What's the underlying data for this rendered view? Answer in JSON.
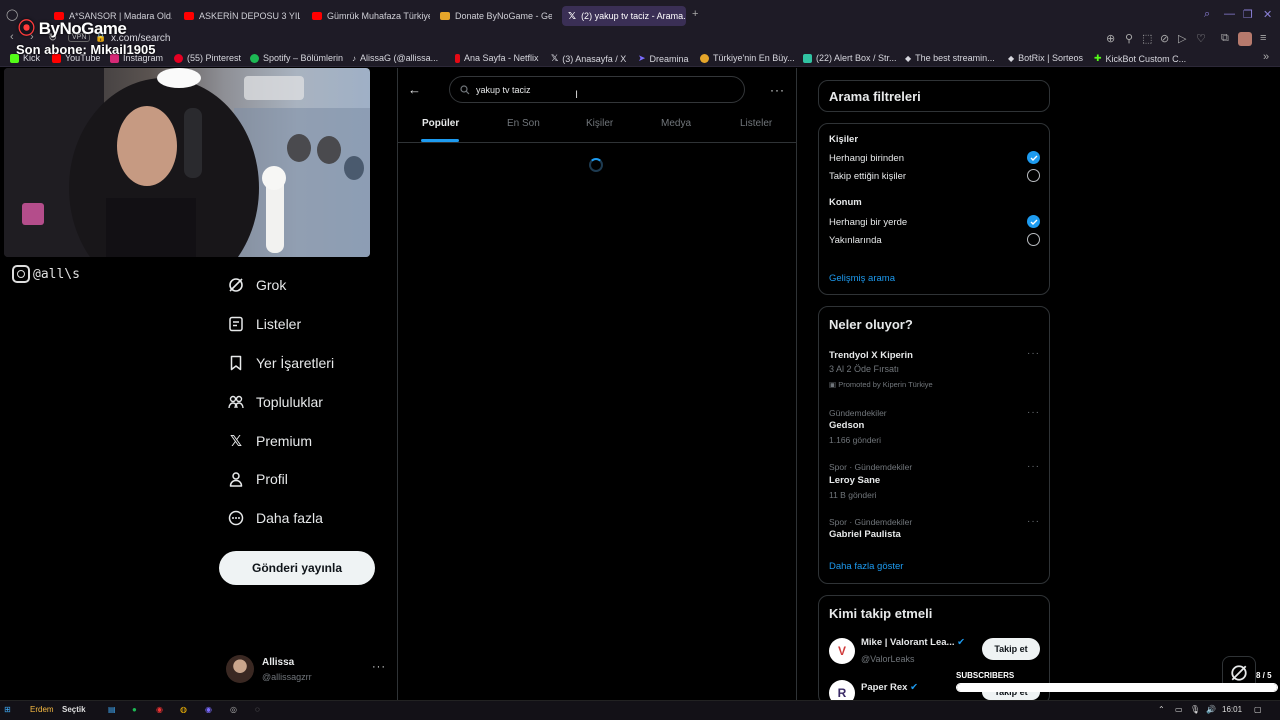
{
  "browser": {
    "tabs": [
      {
        "label": "A*SANSOR | Madara Old...",
        "color": "#ff0000"
      },
      {
        "label": "ASKERİN DEPOSU 3 YIL ...",
        "color": "#ff0000"
      },
      {
        "label": "Gümrük Muhafaza Türkiye...",
        "color": "#ff0000"
      },
      {
        "label": "Donate ByNoGame - Geli...",
        "color": "#e5a52a"
      },
      {
        "label": "(2) yakup tv taciz - Arama...",
        "color": "#ffffff"
      }
    ],
    "vpn_badge": "VPN",
    "url": "x.com/search",
    "bookmarks": [
      {
        "label": "Kick",
        "color": "#53fc18"
      },
      {
        "label": "YouTube",
        "color": "#ff0000"
      },
      {
        "label": "Instagram",
        "color": "#d62976"
      },
      {
        "label": "(55) Pinterest",
        "color": "#e60023"
      },
      {
        "label": "Spotify – Bölümlerin",
        "color": "#1db954"
      },
      {
        "label": "AlissaG (@allissa...",
        "color": "#ffffff"
      },
      {
        "label": "Ana Sayfa - Netflix",
        "color": "#e50914"
      },
      {
        "label": "(3) Anasayfa / X",
        "color": "#ffffff"
      },
      {
        "label": "Dreamina",
        "color": "#7b6cff"
      },
      {
        "label": "Türkiye'nin En Büy...",
        "color": "#e5a52a"
      },
      {
        "label": "(22) Alert Box / Str...",
        "color": "#31c3a2"
      },
      {
        "label": "The best streamin...",
        "color": "#ffffff"
      },
      {
        "label": "BotRix | Sorteos",
        "color": "#ffffff"
      },
      {
        "label": "KickBot Custom C...",
        "color": "#53fc18"
      }
    ]
  },
  "overlay": {
    "brand": "ByNoGame",
    "subscriber_line": "Son abone: Mikail1905",
    "instagram_handle": "@all\\s",
    "subs_label": "SUBSCRIBERS",
    "subs_count": "8 / 5",
    "subs_progress": 1.0
  },
  "nav": {
    "items": [
      {
        "label": "Grok",
        "icon": "grok-icon"
      },
      {
        "label": "Listeler",
        "icon": "lists-icon"
      },
      {
        "label": "Yer İşaretleri",
        "icon": "bookmark-icon"
      },
      {
        "label": "Topluluklar",
        "icon": "communities-icon"
      },
      {
        "label": "Premium",
        "icon": "x-logo-icon"
      },
      {
        "label": "Profil",
        "icon": "profile-icon"
      },
      {
        "label": "Daha fazla",
        "icon": "more-circle-icon"
      }
    ],
    "post_button": "Gönderi yayınla",
    "account": {
      "name": "Allissa",
      "handle": "@allissagzrr"
    }
  },
  "search": {
    "query": "yakup tv taciz",
    "tabs": [
      "Popüler",
      "En Son",
      "Kişiler",
      "Medya",
      "Listeler"
    ],
    "active_tab": "Popüler"
  },
  "filters": {
    "title": "Arama filtreleri",
    "people_heading": "Kişiler",
    "people_options": [
      {
        "label": "Herhangi birinden",
        "selected": true
      },
      {
        "label": "Takip ettiğin kişiler",
        "selected": false
      }
    ],
    "location_heading": "Konum",
    "location_options": [
      {
        "label": "Herhangi bir yerde",
        "selected": true
      },
      {
        "label": "Yakınlarında",
        "selected": false
      }
    ],
    "advanced_link": "Gelişmiş arama"
  },
  "trends": {
    "title": "Neler oluyor?",
    "promoted": {
      "title": "Trendyol X Kiperin",
      "subtitle": "3 Al 2 Öde Fırsatı",
      "promoted_by": "Promoted by Kiperin Türkiye"
    },
    "items": [
      {
        "context": "Gündemdekiler",
        "name": "Gedson",
        "count": "1.166 gönderi"
      },
      {
        "context": "Spor · Gündemdekiler",
        "name": "Leroy Sane",
        "count": "11 B gönderi"
      },
      {
        "context": "Spor · Gündemdekiler",
        "name": "Gabriel Paulista",
        "count": ""
      }
    ],
    "show_more": "Daha fazla göster"
  },
  "who_to_follow": {
    "title": "Kimi takip etmeli",
    "accounts": [
      {
        "name": "Mike | Valorant Lea...",
        "handle": "@ValorLeaks",
        "button": "Takip et"
      },
      {
        "name": "Paper Rex",
        "handle": "",
        "button": "Takip et"
      }
    ]
  },
  "taskbar": {
    "user_label": "Erdem",
    "search_label": "Seçtik",
    "clock": "16:01"
  },
  "colors": {
    "accent": "#1d9bf0",
    "border": "#2f3336",
    "muted": "#71767b"
  }
}
